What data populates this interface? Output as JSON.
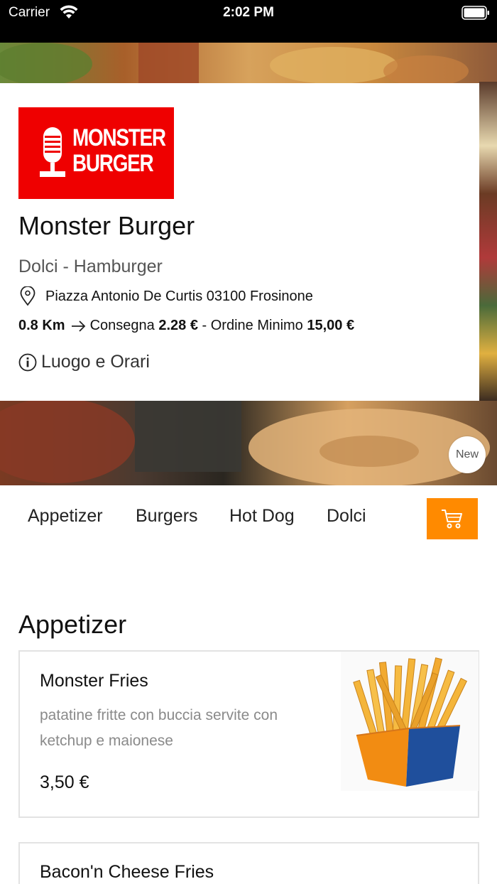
{
  "status_bar": {
    "carrier": "Carrier",
    "time": "2:02 PM"
  },
  "restaurant": {
    "logo_line1": "MONSTER",
    "logo_line2": "BURGER",
    "name": "Monster Burger",
    "categories": "Dolci - Hamburger",
    "address": "Piazza Antonio De Curtis 03100 Frosinone",
    "distance": "0.8 Km",
    "delivery_label": "Consegna",
    "delivery_fee": "2.28 €",
    "separator": "-",
    "min_order_label": "Ordine Minimo",
    "min_order_value": "15,00 €",
    "hours_link": "Luogo e Orari",
    "badge": "New"
  },
  "tabs": [
    {
      "label": "Appetizer"
    },
    {
      "label": "Burgers"
    },
    {
      "label": "Hot Dog"
    },
    {
      "label": "Dolci"
    }
  ],
  "section": {
    "title": "Appetizer",
    "products": [
      {
        "name": "Monster Fries",
        "description": "patatine fritte con buccia servite con ketchup e maionese",
        "price": "3,50 €"
      },
      {
        "name": "Bacon'n Cheese Fries"
      }
    ]
  },
  "colors": {
    "brand_red": "#ef0000",
    "cart_orange": "#ff8a00",
    "card_border": "#e3e3e3"
  },
  "icons": {
    "wifi": "wifi-icon",
    "battery": "battery-icon",
    "pin": "map-pin-icon",
    "arrow": "arrow-right-icon",
    "info": "info-icon",
    "cart": "cart-icon"
  }
}
